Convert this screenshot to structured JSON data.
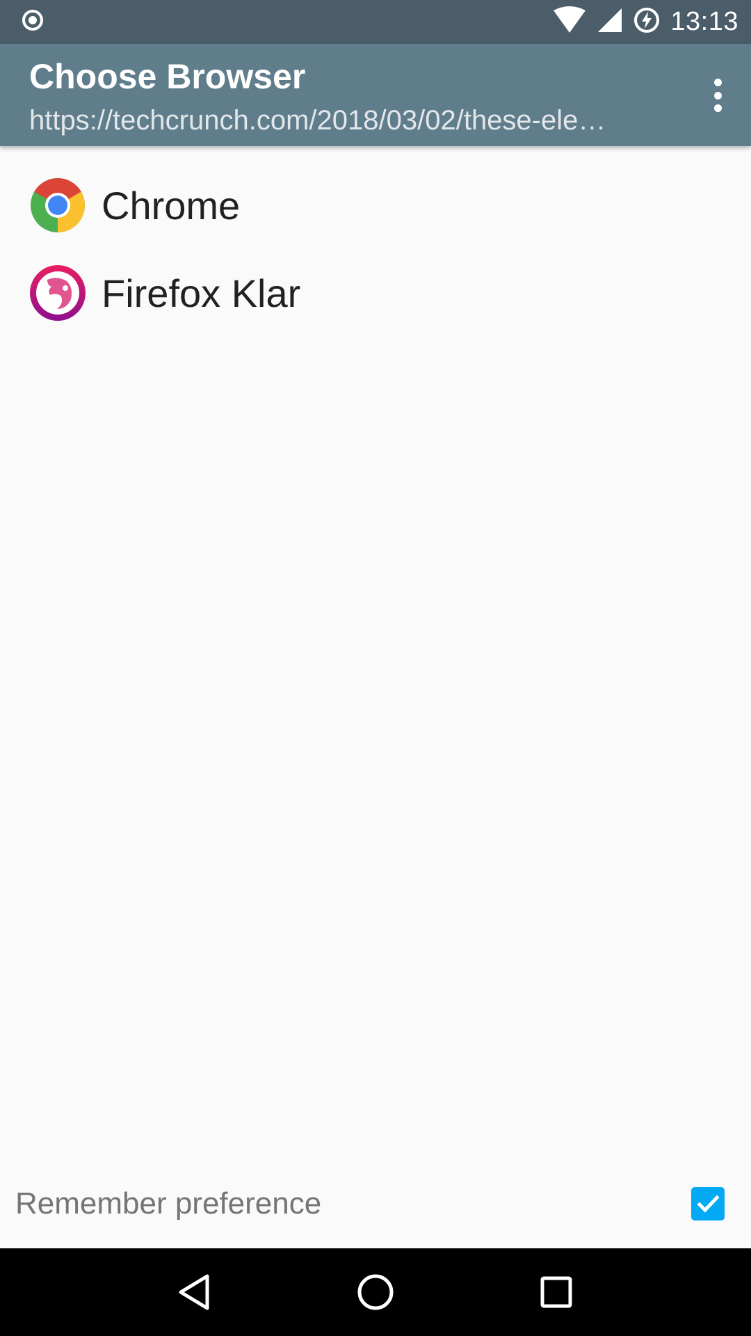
{
  "status_bar": {
    "time": "13:13",
    "icons": [
      "record-icon",
      "wifi-icon",
      "cell-signal-icon",
      "battery-charging-icon"
    ]
  },
  "app_bar": {
    "title": "Choose Browser",
    "subtitle": "https://techcrunch.com/2018/03/02/these-ele…",
    "menu_icon": "overflow-menu-icon",
    "background": "#607d8b"
  },
  "browsers": [
    {
      "label": "Chrome",
      "icon": "chrome-icon"
    },
    {
      "label": "Firefox Klar",
      "icon": "firefox-klar-icon"
    }
  ],
  "remember": {
    "label": "Remember preference",
    "checked": true,
    "accent": "#03a9f4"
  },
  "nav_bar": {
    "buttons": [
      "back-icon",
      "home-icon",
      "recents-icon"
    ]
  }
}
